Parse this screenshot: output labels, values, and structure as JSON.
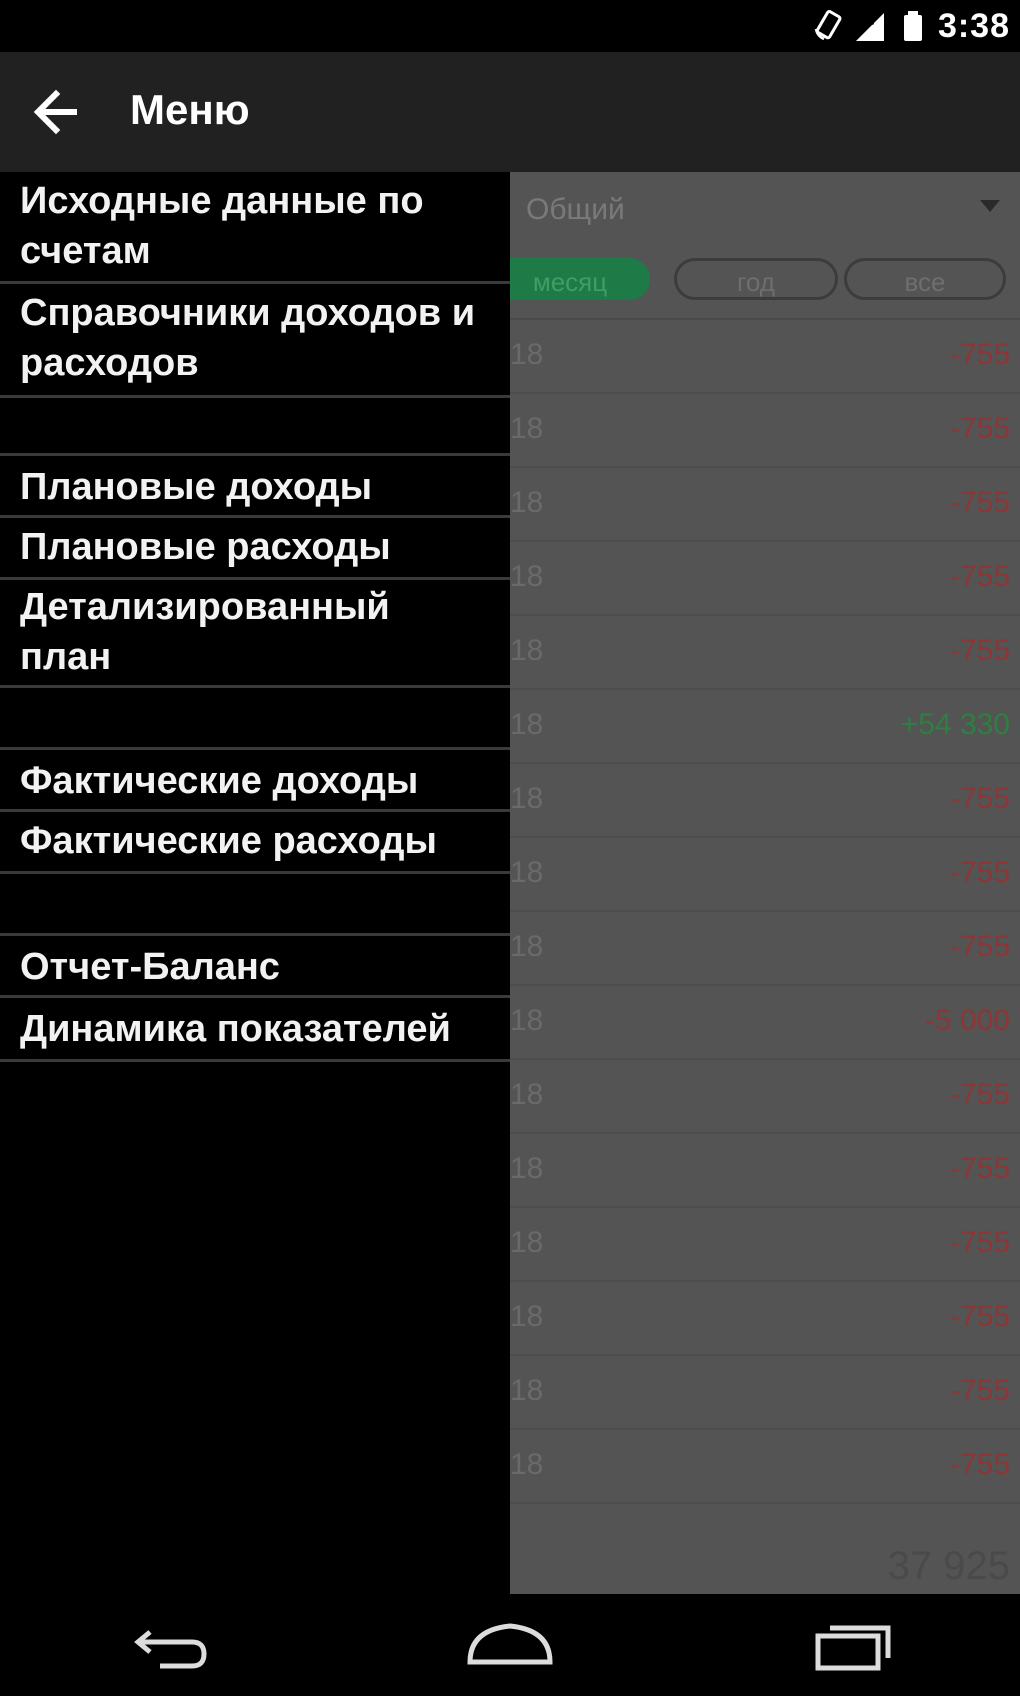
{
  "status": {
    "time": "3:38"
  },
  "actionbar": {
    "title": "Меню"
  },
  "drawer": {
    "items": [
      {
        "label": "Исходные данные по счетам",
        "type": "item"
      },
      {
        "label": "Справочники доходов и расходов",
        "type": "item"
      },
      {
        "label": "",
        "type": "spacer"
      },
      {
        "label": "Плановые доходы",
        "type": "item"
      },
      {
        "label": "Плановые расходы",
        "type": "item"
      },
      {
        "label": "Детализированный план",
        "type": "item"
      },
      {
        "label": "",
        "type": "spacer"
      },
      {
        "label": "Фактические доходы",
        "type": "item"
      },
      {
        "label": "Фактические расходы",
        "type": "item"
      },
      {
        "label": "",
        "type": "spacer"
      },
      {
        "label": "Отчет-Баланс",
        "type": "item"
      },
      {
        "label": "Динамика показателей",
        "type": "item"
      }
    ]
  },
  "background": {
    "account_select": "Общий",
    "tabs": [
      "месяц",
      "год",
      "все"
    ],
    "active_tab": 0,
    "row_date_fragment": "18",
    "rows": [
      "-755",
      "-755",
      "-755",
      "-755",
      "-755",
      "+54 330",
      "-755",
      "-755",
      "-755",
      "-5 000",
      "-755",
      "-755",
      "-755",
      "-755",
      "-755",
      "-755"
    ],
    "total": "37 925"
  },
  "colors": {
    "actionbar": "#212121",
    "drawer": "#000000",
    "active_tab": "#1e7a46",
    "negative": "#8e3535",
    "positive": "#2f7e42"
  }
}
